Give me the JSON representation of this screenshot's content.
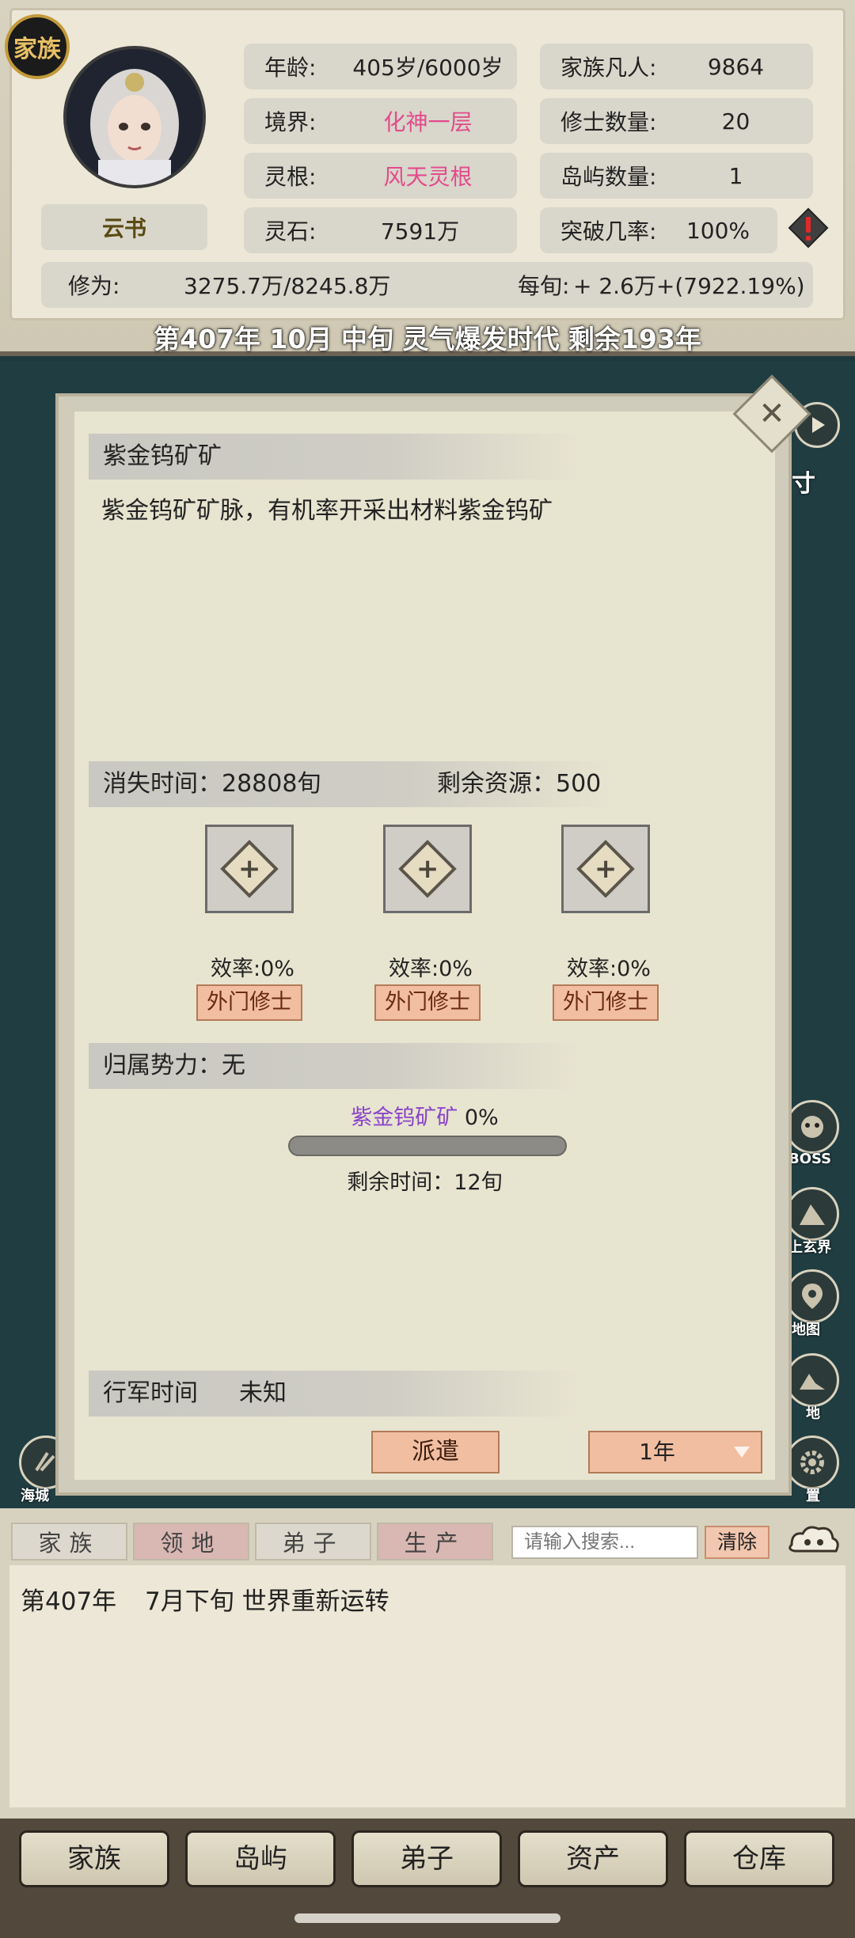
{
  "header": {
    "family_badge": "家族",
    "character_name": "云书",
    "stats": {
      "age_label": "年龄:",
      "age_value": "405岁/6000岁",
      "realm_label": "境界:",
      "realm_value": "化神一层",
      "root_label": "灵根:",
      "root_value": "风天灵根",
      "stone_label": "灵石:",
      "stone_value": "7591万",
      "mortals_label": "家族凡人:",
      "mortals_value": "9864",
      "cultivators_label": "修士数量:",
      "cultivators_value": "20",
      "islands_label": "岛屿数量:",
      "islands_value": "1",
      "breakthrough_label": "突破几率:",
      "breakthrough_value": "100%",
      "cultivation_label": "修为:",
      "cultivation_value": "3275.7万/8245.8万",
      "per_xun_label": "每旬:",
      "per_xun_value": "+ 2.6万+(7922.19%)"
    },
    "date_line": "第407年 10月 中旬  灵气爆发时代 剩余193年"
  },
  "side_buttons": {
    "play_fragment": "寸",
    "boss": "BOSS",
    "upper_realm": "上玄界",
    "map": "地图",
    "land": "地",
    "settings": "置",
    "sea_city": "海城"
  },
  "dialog": {
    "title": "紫金钨矿矿",
    "description": "紫金钨矿矿脉，有机率开采出材料紫金钨矿",
    "vanish_time": "消失时间：28808旬",
    "remaining_resources": "剩余资源：500",
    "slots": [
      {
        "efficiency": "效率:0%",
        "button": "外门修士"
      },
      {
        "efficiency": "效率:0%",
        "button": "外门修士"
      },
      {
        "efficiency": "效率:0%",
        "button": "外门修士"
      }
    ],
    "faction": "归属势力：无",
    "progress_name": "紫金钨矿矿",
    "progress_pct": "0%",
    "progress_fraction": 0,
    "remaining_time": "剩余时间：12旬",
    "march_label": "行军时间",
    "march_value": "未知",
    "dispatch": "派遣",
    "duration": "1年"
  },
  "log": {
    "tabs": [
      "家族",
      "领地",
      "弟子",
      "生产"
    ],
    "search_placeholder": "请输入搜索...",
    "clear": "清除",
    "entry_year": "第407年",
    "entry_text": "7月下旬 世界重新运转"
  },
  "bottom_nav": [
    "家族",
    "岛屿",
    "弟子",
    "资产",
    "仓库"
  ],
  "colors": {
    "accent_pink": "#e34b8c",
    "progress_purple": "#a36fd6",
    "button_peach": "#f2bea1"
  }
}
